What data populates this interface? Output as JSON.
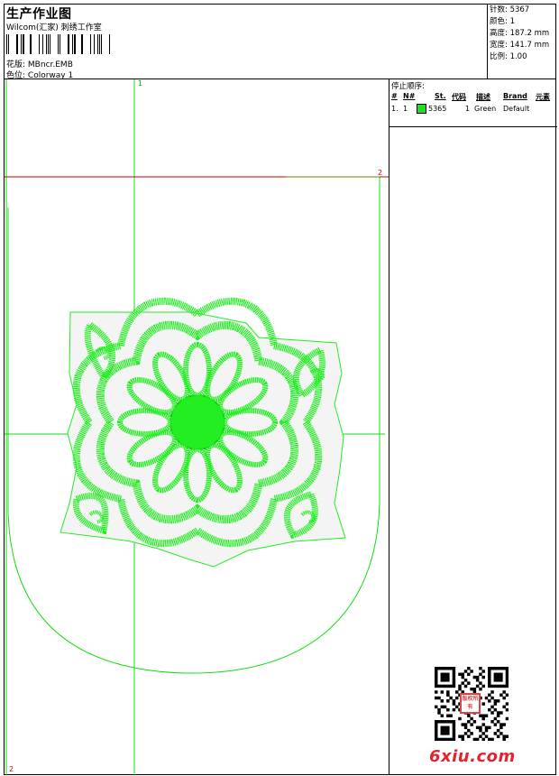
{
  "header": {
    "title": "生产作业图",
    "subtitle": "Wilcom(汇家) 刺绣工作室",
    "design_label": "花版:",
    "design_value": "MBncr.EMB",
    "color_label": "色位:",
    "color_value": "Colorway 1"
  },
  "stats": {
    "stitches": "针数: 5367",
    "colors": "颜色: 1",
    "height": "高度: 187.2 mm",
    "width": "宽度: 141.7 mm",
    "scale": "比例: 1.00"
  },
  "stop_sequence": {
    "heading": "停止顺序:",
    "columns": [
      "#",
      "N#",
      "St.",
      "代码",
      "描述",
      "Brand",
      "元素"
    ],
    "rows": [
      {
        "index": "1.",
        "needle": "1",
        "swatch_color": "#22dd22",
        "stitches": "5365",
        "code": "1",
        "description": "Green",
        "brand": "Default",
        "element": ""
      }
    ]
  },
  "canvas": {
    "marker_top": "1",
    "marker_right": "2",
    "marker_bottom": "2",
    "stitch_color": "#22ee22",
    "guide_green": "#00cc00",
    "guide_red": "#cc0000"
  },
  "watermark": {
    "text": "6xiu.com",
    "seal_text": "版权所有"
  }
}
